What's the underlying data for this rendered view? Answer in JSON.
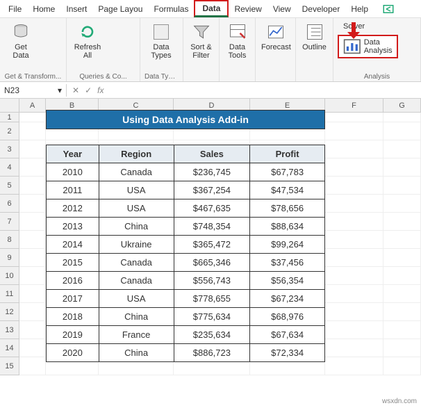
{
  "menubar": {
    "tabs": [
      "File",
      "Home",
      "Insert",
      "Page Layou",
      "Formulas",
      "Data",
      "Review",
      "View",
      "Developer",
      "Help"
    ],
    "active": "Data"
  },
  "ribbon": {
    "get_transform": {
      "label": "Get & Transform...",
      "get_data": "Get\nData"
    },
    "queries": {
      "label": "Queries & Co...",
      "refresh_all": "Refresh\nAll"
    },
    "data_types": {
      "label": "Data Types",
      "data_types_btn": "Data\nTypes"
    },
    "sort_filter": {
      "label": "Sort &\nFilter"
    },
    "data_tools": {
      "label": "Data\nTools"
    },
    "forecast": {
      "label": "Forecast"
    },
    "outline": {
      "label": "Outline"
    },
    "analysis": {
      "label": "Analysis",
      "solver": "Solver",
      "data_analysis": "Data Analysis"
    }
  },
  "formulabar": {
    "namebox": "N23",
    "fx": "fx"
  },
  "columns": [
    "A",
    "B",
    "C",
    "D",
    "E",
    "F",
    "G"
  ],
  "title_banner": "Using Data Analysis Add-in",
  "table": {
    "headers": [
      "Year",
      "Region",
      "Sales",
      "Profit"
    ],
    "rows": [
      [
        "2010",
        "Canada",
        "$236,745",
        "$67,783"
      ],
      [
        "2011",
        "USA",
        "$367,254",
        "$47,534"
      ],
      [
        "2012",
        "USA",
        "$467,635",
        "$78,656"
      ],
      [
        "2013",
        "China",
        "$748,354",
        "$88,634"
      ],
      [
        "2014",
        "Ukraine",
        "$365,472",
        "$99,264"
      ],
      [
        "2015",
        "Canada",
        "$665,346",
        "$37,456"
      ],
      [
        "2016",
        "Canada",
        "$556,743",
        "$56,354"
      ],
      [
        "2017",
        "USA",
        "$778,655",
        "$67,234"
      ],
      [
        "2018",
        "China",
        "$775,634",
        "$68,976"
      ],
      [
        "2019",
        "France",
        "$235,634",
        "$67,634"
      ],
      [
        "2020",
        "China",
        "$886,723",
        "$72,334"
      ]
    ]
  },
  "watermark": "wsxdn.com",
  "chart_data": {
    "type": "table",
    "title": "Using Data Analysis Add-in",
    "columns": [
      "Year",
      "Region",
      "Sales",
      "Profit"
    ],
    "rows": [
      {
        "Year": 2010,
        "Region": "Canada",
        "Sales": 236745,
        "Profit": 67783
      },
      {
        "Year": 2011,
        "Region": "USA",
        "Sales": 367254,
        "Profit": 47534
      },
      {
        "Year": 2012,
        "Region": "USA",
        "Sales": 467635,
        "Profit": 78656
      },
      {
        "Year": 2013,
        "Region": "China",
        "Sales": 748354,
        "Profit": 88634
      },
      {
        "Year": 2014,
        "Region": "Ukraine",
        "Sales": 365472,
        "Profit": 99264
      },
      {
        "Year": 2015,
        "Region": "Canada",
        "Sales": 665346,
        "Profit": 37456
      },
      {
        "Year": 2016,
        "Region": "Canada",
        "Sales": 556743,
        "Profit": 56354
      },
      {
        "Year": 2017,
        "Region": "USA",
        "Sales": 778655,
        "Profit": 67234
      },
      {
        "Year": 2018,
        "Region": "China",
        "Sales": 775634,
        "Profit": 68976
      },
      {
        "Year": 2019,
        "Region": "France",
        "Sales": 235634,
        "Profit": 67634
      },
      {
        "Year": 2020,
        "Region": "China",
        "Sales": 886723,
        "Profit": 72334
      }
    ]
  }
}
